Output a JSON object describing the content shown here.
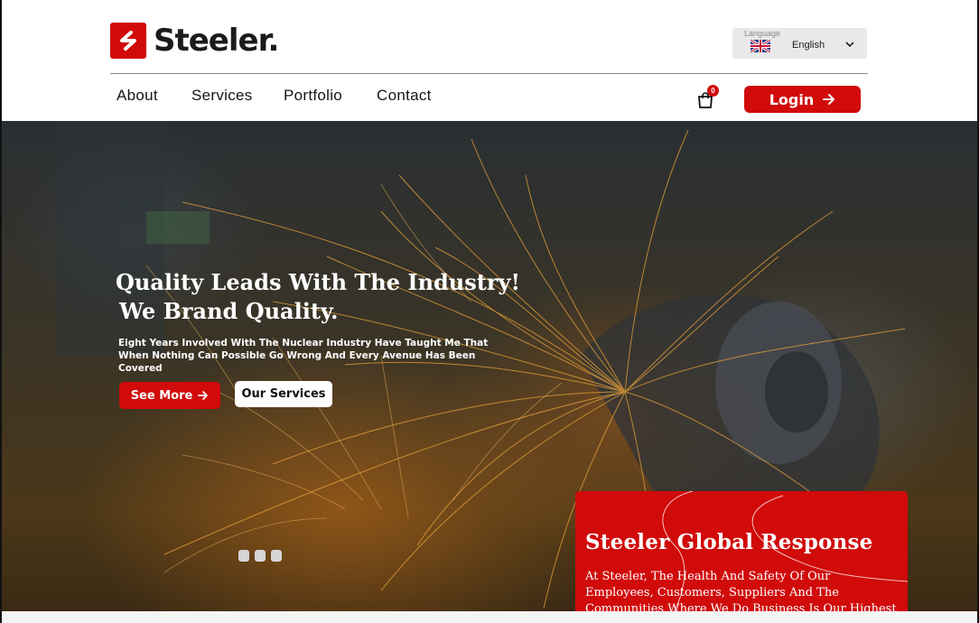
{
  "brand": {
    "name": "Steeler.",
    "accent": "#d10a0a"
  },
  "language": {
    "caption": "Language",
    "selected": "English",
    "flag_icon": "uk-flag-icon"
  },
  "nav": {
    "items": [
      {
        "label": "About"
      },
      {
        "label": "Services"
      },
      {
        "label": "Portfolio"
      },
      {
        "label": "Contact"
      }
    ]
  },
  "cart": {
    "count": "0",
    "icon": "shopping-bag-icon"
  },
  "login": {
    "label": "Login"
  },
  "hero": {
    "title_line1": "Quality Leads With The Industry!",
    "title_line2": "We Brand Quality.",
    "subtitle": "Eight Years Involved With The Nuclear Industry Have Taught Me That When Nothing Can Possible Go Wrong And Every Avenue Has Been Covered",
    "primary_button": "See More",
    "secondary_button": "Our Services",
    "slide_count": 3
  },
  "response_card": {
    "title": "Steeler Global Response",
    "text": "At Steeler, The Health And Safety Of Our Employees, Customers, Suppliers And The Communities Where We Do Business Is Our Highest Priority."
  }
}
